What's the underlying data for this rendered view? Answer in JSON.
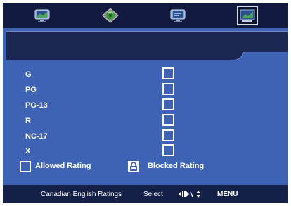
{
  "menu_bar": {
    "tabs": [
      {
        "icon": "tv-picture-icon",
        "selected": false
      },
      {
        "icon": "sound-disc-icon",
        "selected": false
      },
      {
        "icon": "tv-channel-icon",
        "selected": false
      },
      {
        "icon": "lock-settings-icon",
        "selected": true
      }
    ]
  },
  "banner": {
    "title": ""
  },
  "ratings": [
    {
      "label": "G",
      "blocked": false
    },
    {
      "label": "PG",
      "blocked": false
    },
    {
      "label": "PG-13",
      "blocked": false
    },
    {
      "label": "R",
      "blocked": false
    },
    {
      "label": "NC-17",
      "blocked": false
    },
    {
      "label": "X",
      "blocked": false
    }
  ],
  "legend": {
    "allowed_label": "Allowed Rating",
    "blocked_label": "Blocked Rating"
  },
  "footer": {
    "ratings_label": "Canadian English Ratings",
    "select_label": "Select",
    "menu_label": "MENU"
  },
  "colors": {
    "background": "#3f63b4",
    "bars": "#142048",
    "text": "#ffffff"
  }
}
